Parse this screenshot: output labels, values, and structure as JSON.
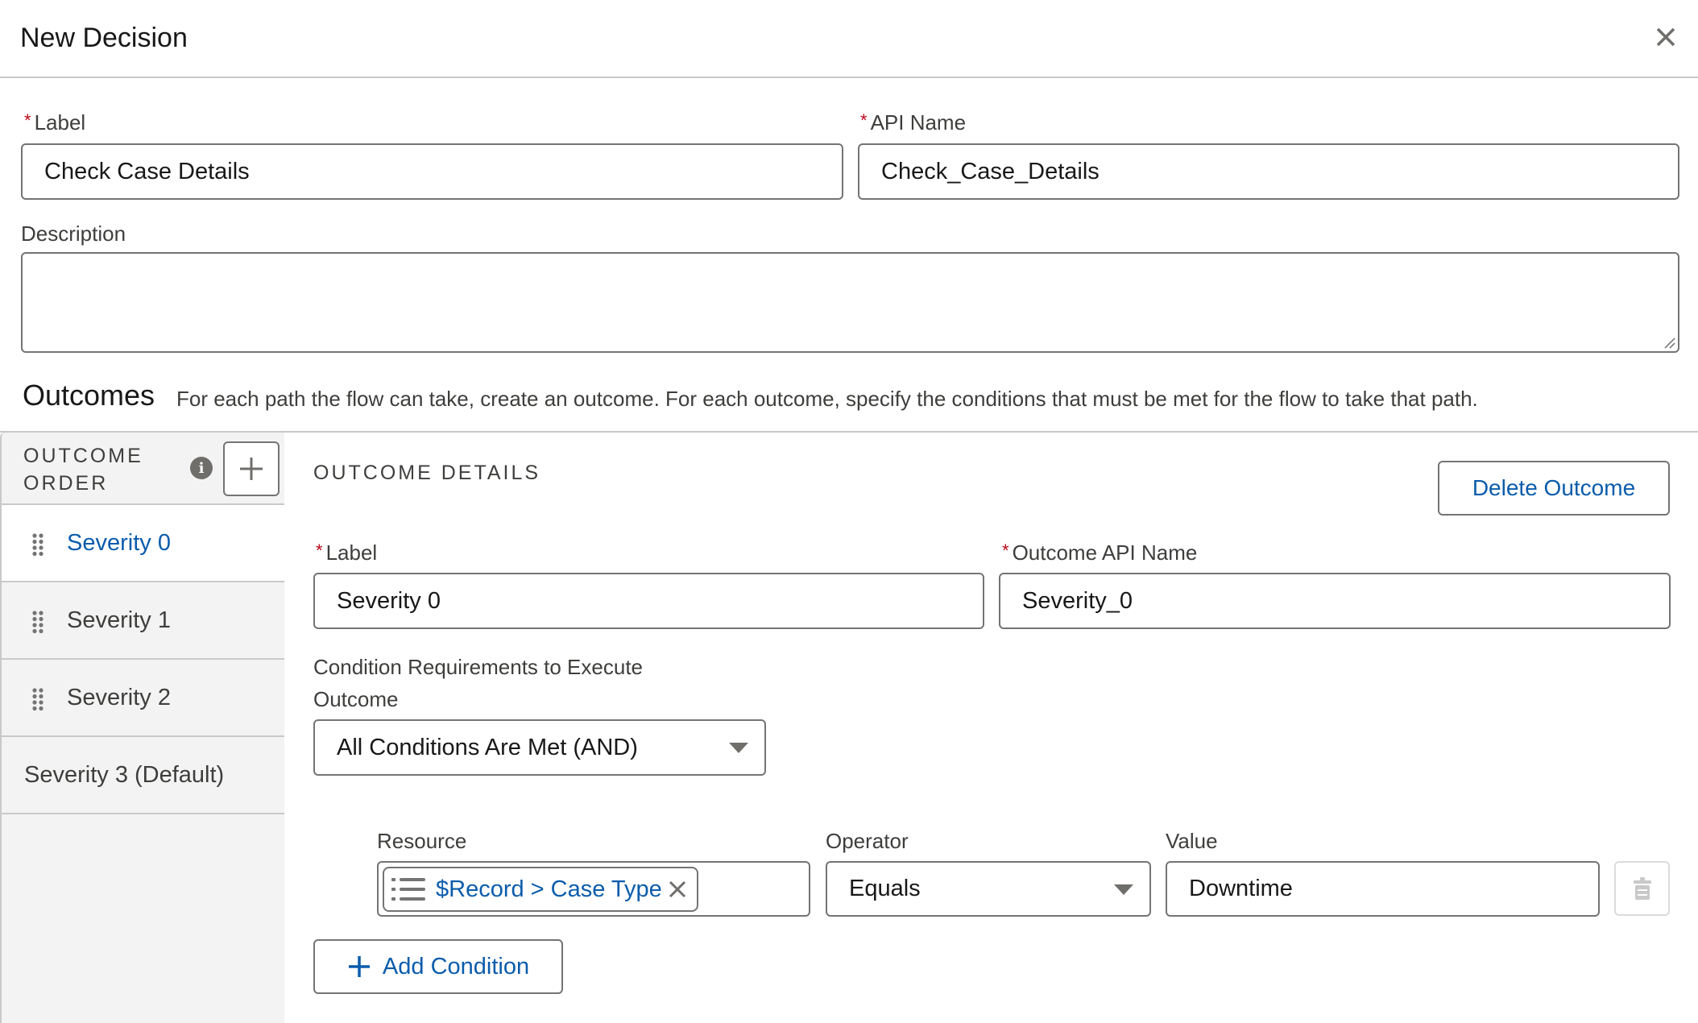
{
  "modal": {
    "title": "New Decision",
    "close_icon": "close-icon"
  },
  "form": {
    "label": {
      "label": "Label",
      "required": true,
      "value": "Check Case Details"
    },
    "api_name": {
      "label": "API Name",
      "required": true,
      "value": "Check_Case_Details"
    },
    "description": {
      "label": "Description",
      "value": ""
    }
  },
  "outcomes": {
    "title": "Outcomes",
    "help_text": "For each path the flow can take, create an outcome. For each outcome, specify the conditions that must be met for the flow to take that path.",
    "sidebar": {
      "header": "OUTCOME ORDER",
      "info_icon": "info-icon",
      "add_icon": "add-icon",
      "items": [
        {
          "label": "Severity 0",
          "selected": true,
          "draggable": true
        },
        {
          "label": "Severity 1",
          "selected": false,
          "draggable": true
        },
        {
          "label": "Severity 2",
          "selected": false,
          "draggable": true
        },
        {
          "label": "Severity 3 (Default)",
          "selected": false,
          "draggable": false
        }
      ]
    },
    "details": {
      "title": "OUTCOME DETAILS",
      "delete_button": "Delete Outcome",
      "label": {
        "label": "Label",
        "required": true,
        "value": "Severity 0"
      },
      "api_name": {
        "label": "Outcome API Name",
        "required": true,
        "value": "Severity_0"
      },
      "condition_requirements": {
        "label_line1": "Condition Requirements to Execute",
        "label_line2": "Outcome",
        "value": "All Conditions Are Met (AND)"
      },
      "conditions": [
        {
          "resource_label": "Resource",
          "resource_value": "$Record > Case Type",
          "operator_label": "Operator",
          "operator_value": "Equals",
          "value_label": "Value",
          "value": "Downtime"
        }
      ],
      "add_condition_button": "Add Condition"
    }
  },
  "colors": {
    "brand_blue": "#0b5cab",
    "required_red": "#ba0517",
    "border": "#747474",
    "sidebar_bg": "#f3f3f3"
  }
}
